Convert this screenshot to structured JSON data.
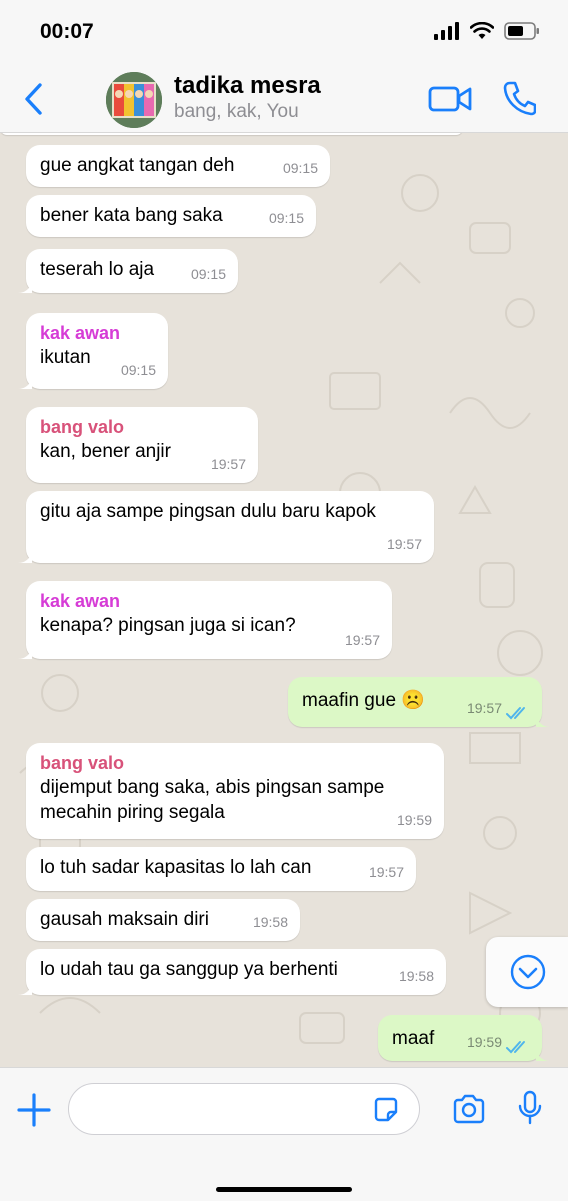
{
  "status": {
    "time": "00:07"
  },
  "header": {
    "title": "tadika mesra",
    "subtitle": "bang, kak, You"
  },
  "colors": {
    "accent": "#1a7ffb",
    "incoming_bubble": "#ffffff",
    "outgoing_bubble": "#dcf8c6",
    "chat_background": "#e7e2da",
    "sender_kak_awan": "#d63cd6",
    "sender_bang_valo": "#d8527a",
    "read_ticks": "#4fb5ec"
  },
  "messages": [
    {
      "text": "gue angkat tangan deh",
      "time": "09:15"
    },
    {
      "text": "bener kata bang saka",
      "time": "09:15"
    },
    {
      "text": "teserah lo aja",
      "time": "09:15"
    },
    {
      "sender": "kak awan",
      "text": "ikutan",
      "time": "09:15"
    },
    {
      "sender": "bang valo",
      "text": "kan, bener anjir",
      "time": "19:57"
    },
    {
      "text": "gitu aja sampe pingsan dulu baru kapok",
      "time": "19:57"
    },
    {
      "sender": "kak awan",
      "text": "kenapa? pingsan juga si ican?",
      "time": "19:57"
    },
    {
      "text": "maafin gue ☹️",
      "time": "19:57",
      "outgoing": true
    },
    {
      "sender": "bang valo",
      "text": "dijemput bang saka, abis pingsan sampe mecahin piring segala",
      "time": "19:59"
    },
    {
      "text": "lo tuh sadar kapasitas lo lah can",
      "time": "19:57"
    },
    {
      "text": "gausah maksain diri",
      "time": "19:58"
    },
    {
      "text": "lo udah tau ga sanggup ya berhenti",
      "time": "19:58"
    },
    {
      "text": "maaf",
      "time": "19:59",
      "outgoing": true
    }
  ],
  "input": {
    "value": "",
    "placeholder": ""
  },
  "icons": {
    "back": "chevron-left-icon",
    "video": "video-camera-icon",
    "call": "phone-icon",
    "plus": "plus-icon",
    "sticker": "sticker-icon",
    "camera": "camera-icon",
    "mic": "microphone-icon",
    "scroll": "chevron-down-circle-icon"
  }
}
